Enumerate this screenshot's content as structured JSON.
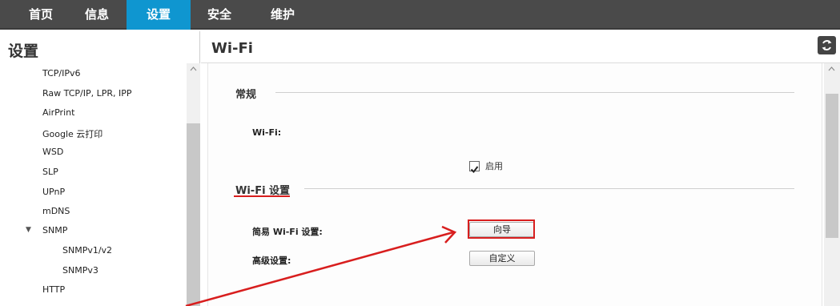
{
  "topnav": {
    "tabs": [
      {
        "label": "首页"
      },
      {
        "label": "信息"
      },
      {
        "label": "设置"
      },
      {
        "label": "安全"
      },
      {
        "label": "维护"
      }
    ],
    "active_color": "#0f96d0"
  },
  "sidebar": {
    "title": "设置",
    "items": [
      {
        "label": "TCP/IPv6"
      },
      {
        "label": "Raw TCP/IP, LPR, IPP"
      },
      {
        "label": "AirPrint"
      },
      {
        "label": "Google 云打印"
      },
      {
        "label": "WSD"
      },
      {
        "label": "SLP"
      },
      {
        "label": "UPnP"
      },
      {
        "label": "mDNS"
      },
      {
        "label": "SNMP"
      },
      {
        "label": "SNMPv1/v2"
      },
      {
        "label": "SNMPv3"
      },
      {
        "label": "HTTP"
      }
    ]
  },
  "main": {
    "title": "Wi-Fi",
    "general": {
      "title": "常规",
      "wifi_label": "Wi-Fi:",
      "enable_label": "启用",
      "enabled": true
    },
    "wifi_settings": {
      "title": "Wi-Fi 设置",
      "easy_label": "简易 Wi-Fi 设置:",
      "wizard_button": "向导",
      "advanced_label": "高级设置:",
      "custom_button": "自定义"
    }
  },
  "annotation_color": "#d81e1e"
}
